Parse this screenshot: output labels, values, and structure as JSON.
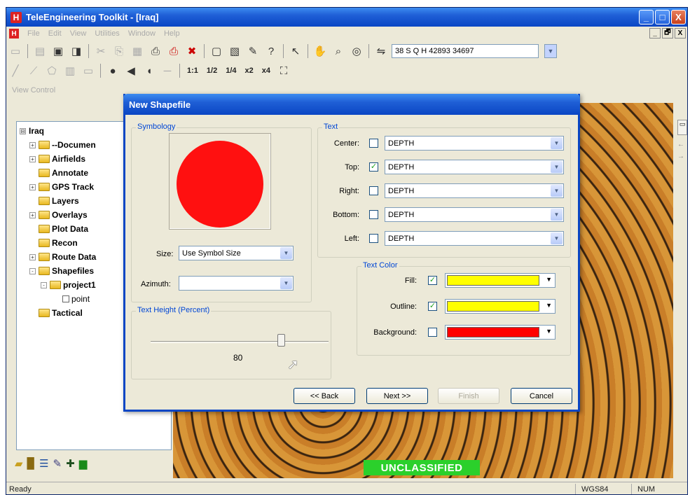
{
  "app": {
    "title": "TeleEngineering Toolkit - [Iraq]",
    "icon_letter": "H",
    "menu": [
      "File",
      "Edit",
      "View",
      "Utilities",
      "Window",
      "Help"
    ],
    "window_buttons": [
      "_",
      "□",
      "X"
    ],
    "mdi_buttons": [
      "_",
      "🗗",
      "X"
    ]
  },
  "toolbar": {
    "coordinate": "38 S Q H 42893 34697",
    "zoom_labels": [
      "1:1",
      "1/2",
      "1/4",
      "x2",
      "x4"
    ]
  },
  "left_panel": {
    "caption": "View Control",
    "tree": [
      {
        "label": "Iraq",
        "expander": "⊟",
        "folder": false,
        "depth": 0
      },
      {
        "label": "--Documen",
        "expander": "+",
        "folder": true,
        "depth": 1
      },
      {
        "label": "Airfields",
        "expander": "+",
        "folder": true,
        "depth": 1
      },
      {
        "label": "Annotate",
        "expander": "",
        "folder": true,
        "depth": 1
      },
      {
        "label": "GPS Track",
        "expander": "+",
        "folder": true,
        "depth": 1
      },
      {
        "label": "Layers",
        "expander": "",
        "folder": true,
        "depth": 1
      },
      {
        "label": "Overlays",
        "expander": "+",
        "folder": true,
        "depth": 1
      },
      {
        "label": "Plot Data",
        "expander": "",
        "folder": true,
        "depth": 1
      },
      {
        "label": "Recon",
        "expander": "",
        "folder": true,
        "depth": 1
      },
      {
        "label": "Route Data",
        "expander": "+",
        "folder": true,
        "depth": 1
      },
      {
        "label": "Shapefiles",
        "expander": "-",
        "folder": true,
        "depth": 1
      },
      {
        "label": "project1",
        "expander": "-",
        "folder": true,
        "depth": 2
      },
      {
        "label": "point",
        "expander": "",
        "folder": false,
        "checkbox": true,
        "depth": 3
      },
      {
        "label": "Tactical",
        "expander": "",
        "folder": true,
        "depth": 1
      }
    ]
  },
  "map": {
    "classification": "UNCLASSIFIED",
    "classification_color": "#2bd02b"
  },
  "status": {
    "ready": "Ready",
    "datum": "WGS84",
    "num": "NUM"
  },
  "dialog": {
    "title": "New Shapefile",
    "symbology": {
      "label": "Symbology",
      "symbol_color": "#ff1010",
      "size_label": "Size:",
      "size_value": "Use Symbol Size",
      "azimuth_label": "Azimuth:",
      "azimuth_value": ""
    },
    "text_height": {
      "label": "Text Height (Percent)",
      "value": "80",
      "slider_fraction": 0.8
    },
    "text": {
      "label": "Text",
      "rows": [
        {
          "label": "Center:",
          "checked": false,
          "value": "DEPTH"
        },
        {
          "label": "Top:",
          "checked": true,
          "value": "DEPTH"
        },
        {
          "label": "Right:",
          "checked": false,
          "value": "DEPTH"
        },
        {
          "label": "Bottom:",
          "checked": false,
          "value": "DEPTH"
        },
        {
          "label": "Left:",
          "checked": false,
          "value": "DEPTH"
        }
      ]
    },
    "text_color": {
      "label": "Text Color",
      "rows": [
        {
          "label": "Fill:",
          "checked": true,
          "color": "#ffff00"
        },
        {
          "label": "Outline:",
          "checked": true,
          "color": "#ffff00"
        },
        {
          "label": "Background:",
          "checked": false,
          "color": "#ff0000"
        }
      ]
    },
    "buttons": {
      "back": "<< Back",
      "next": "Next >>",
      "finish": "Finish",
      "cancel": "Cancel"
    }
  }
}
